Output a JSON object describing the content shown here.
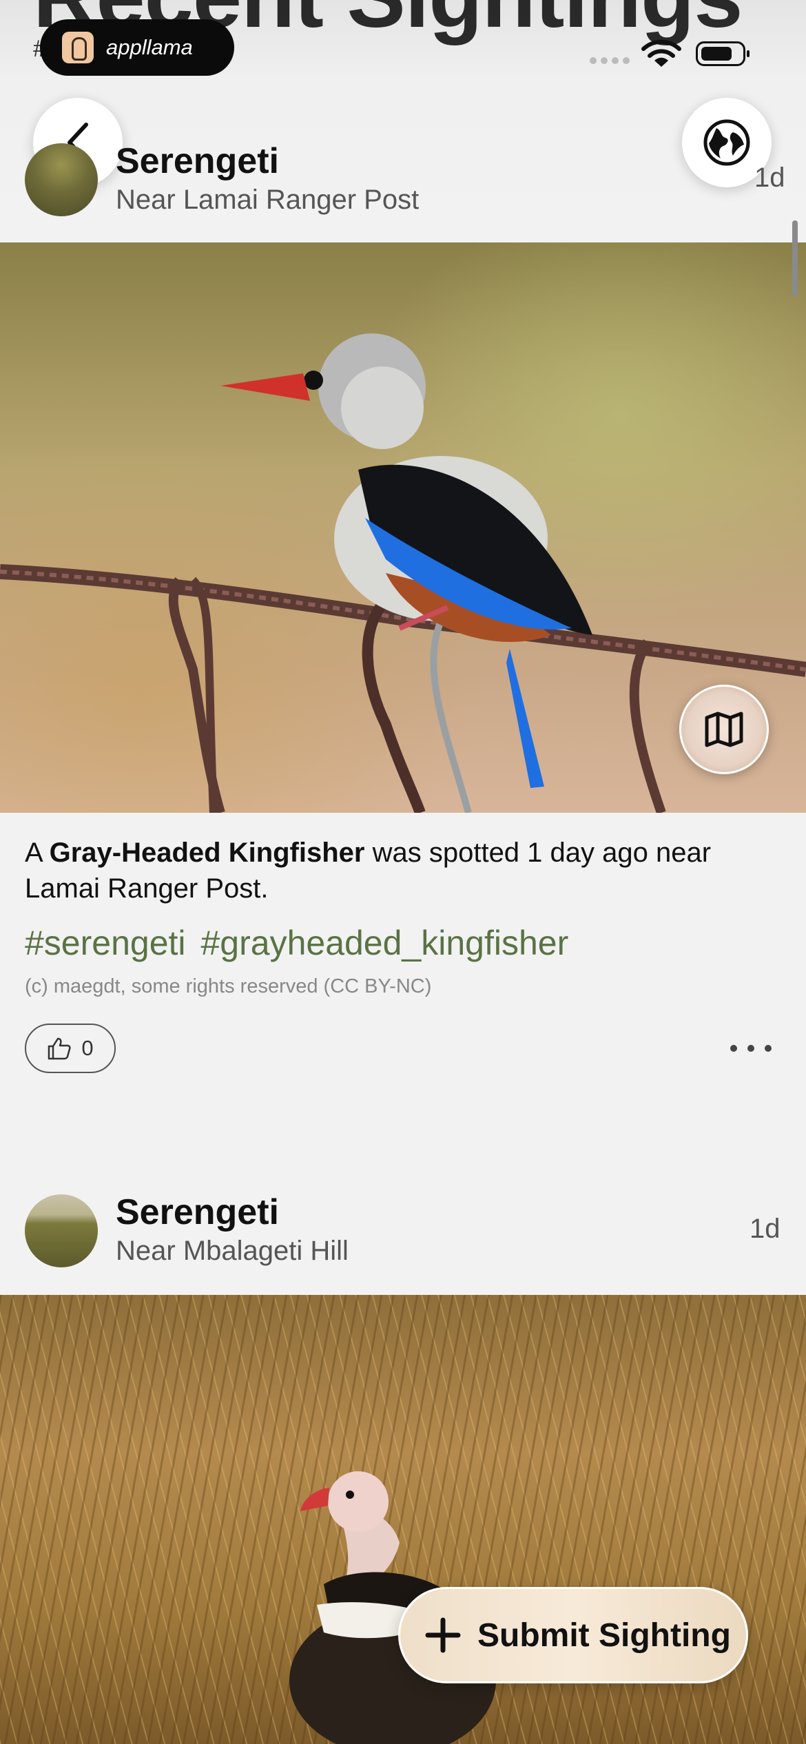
{
  "page": {
    "background_title": "Recent Sightings",
    "hash_peek": "#"
  },
  "status_bar": {
    "badge_label": "appllama"
  },
  "nav": {
    "back_icon": "chevron-left-icon",
    "globe_icon": "globe-icon"
  },
  "posts": [
    {
      "park": "Serengeti",
      "location": "Near Lamai Ranger Post",
      "age": "1d",
      "caption_pre": "A ",
      "species": "Gray-Headed Kingfisher",
      "caption_post": " was spotted 1 day ago near Lamai Ranger Post.",
      "tags": [
        "#serengeti",
        "#grayheaded_kingfisher"
      ],
      "credit": "(c) maegdt, some rights reserved (CC BY-NC)",
      "likes": "0",
      "map_icon": "map-icon"
    },
    {
      "park": "Serengeti",
      "location": "Near Mbalageti Hill",
      "age": "1d"
    }
  ],
  "actions": {
    "submit_label": "Submit Sighting"
  },
  "colors": {
    "tag": "#5a7245",
    "background": "#f2f2f2",
    "submit_bg": "#f2e3cf"
  }
}
